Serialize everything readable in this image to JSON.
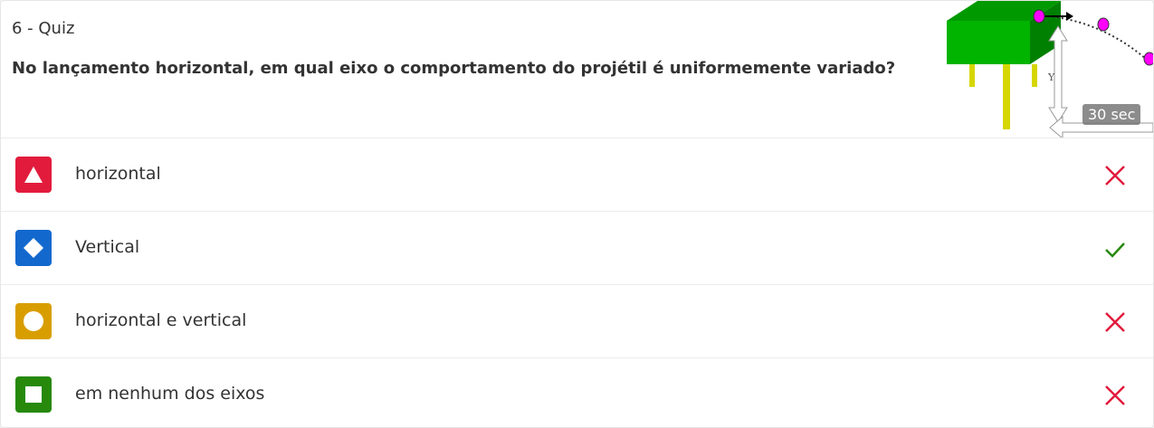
{
  "question": {
    "number_label": "6 - Quiz",
    "text": "No lançamento horizontal, em qual eixo o comportamento do projétil é uniformemente variado?",
    "timer": "30 sec",
    "illustration": {
      "axis_label": "Y"
    }
  },
  "options": [
    {
      "label": "horizontal",
      "shape": "triangle-icon",
      "color": "#e21b3c",
      "result": "incorrect"
    },
    {
      "label": "Vertical",
      "shape": "diamond-icon",
      "color": "#1368ce",
      "result": "correct"
    },
    {
      "label": "horizontal e vertical",
      "shape": "circle-icon",
      "color": "#d89e00",
      "result": "incorrect"
    },
    {
      "label": "em nenhum dos eixos",
      "shape": "square-icon",
      "color": "#26890c",
      "result": "incorrect"
    }
  ],
  "colors": {
    "incorrect": "#e21b3c",
    "correct": "#26890c"
  }
}
